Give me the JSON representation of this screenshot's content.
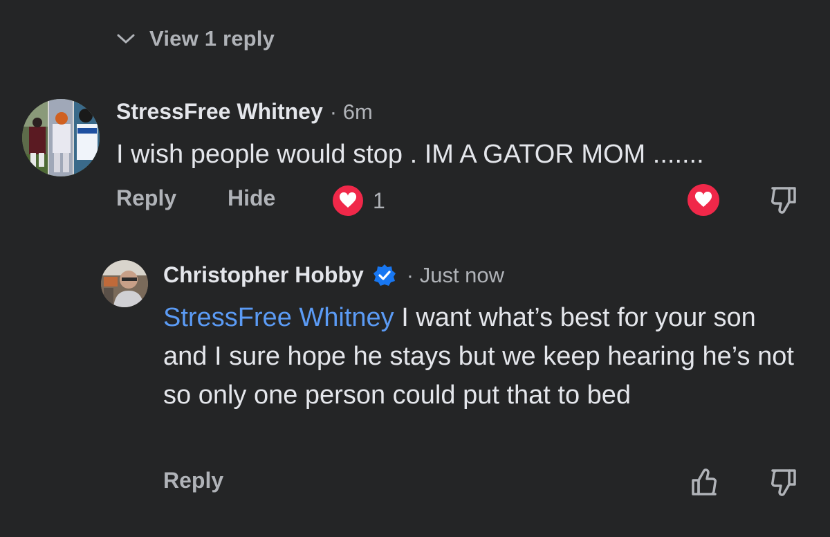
{
  "view_replies": {
    "label": "View 1 reply",
    "icon": "chevron-down-icon"
  },
  "comments": [
    {
      "author": "StressFree Whitney",
      "time": "· 6m",
      "text": "I wish people would stop . IM A GATOR MOM .......",
      "actions": {
        "reply": "Reply",
        "hide": "Hide"
      },
      "reaction_count": "1"
    },
    {
      "author": "Christopher Hobby",
      "verified": true,
      "time": "· Just now",
      "mention": "StressFree Whitney",
      "text": " I want what’s best for your son and I sure hope he stays but we keep hearing he’s not so only one person could put that to bed",
      "actions": {
        "reply": "Reply"
      }
    }
  ],
  "colors": {
    "background": "#242526",
    "heart": "#f02849",
    "mention": "#5b9bf5",
    "verified": "#1877f2"
  }
}
